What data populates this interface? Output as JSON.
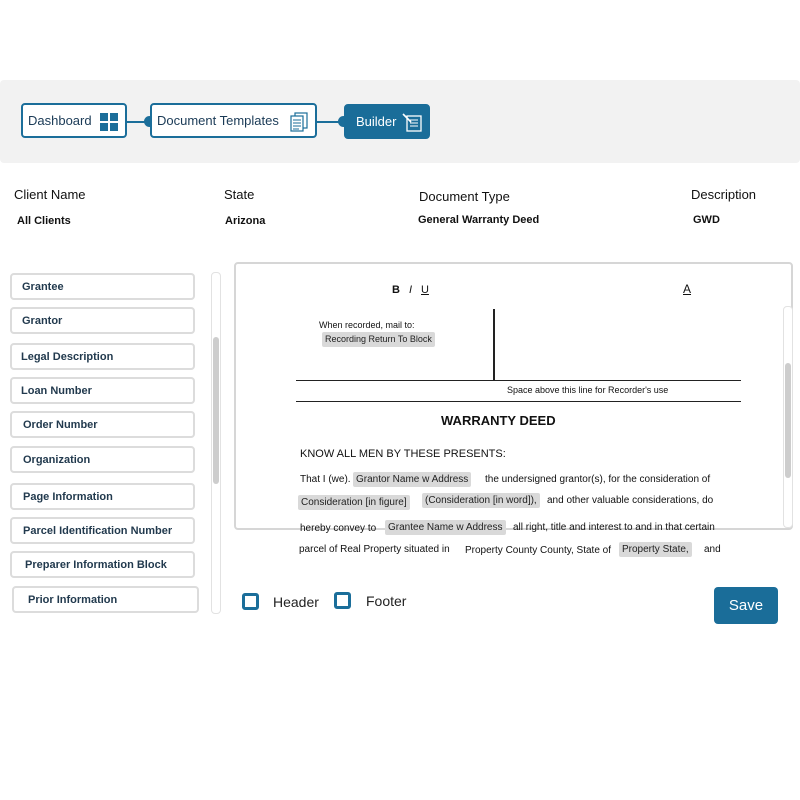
{
  "breadcrumb": {
    "dashboard": "Dashboard",
    "templates": "Document Templates",
    "builder": "Builder"
  },
  "info": {
    "client_label": "Client Name",
    "client_value": "All Clients",
    "state_label": "State",
    "state_value": "Arizona",
    "doctype_label": "Document Type",
    "doctype_value": "General Warranty Deed",
    "desc_label": "Description",
    "desc_value": "GWD"
  },
  "fields": [
    "Grantee",
    "Grantor",
    "Legal Description",
    "Loan Number",
    "Order Number",
    "Organization",
    "Page Information",
    "Parcel Identification Number",
    "Preparer Information Block",
    "Prior Information"
  ],
  "toolbar": {
    "bold": "B",
    "italic": "I",
    "underline": "U",
    "font_color": "A"
  },
  "document": {
    "mail_to": "When recorded, mail to:",
    "recording_tag": "Recording Return To Block",
    "recorder_note": "Space above this line for Recorder's use",
    "title": "WARRANTY DEED",
    "know_all": "KNOW ALL MEN BY THESE PRESENTS:",
    "l1_a": "That I (we).",
    "tag_grantor": "Grantor Name w Address",
    "l1_b": "the undersigned grantor(s), for the consideration of",
    "tag_cons_fig": "Consideration [in figure]",
    "tag_cons_word": "(Consideration [in word]),",
    "l2_b": "and other valuable considerations, do",
    "l3_a": "hereby convey to",
    "tag_grantee": "Grantee Name w Address",
    "l3_b": "all right, title and interest to and in that certain",
    "l4_a": "parcel of Real Property situated in",
    "l4_b": "Property County County, State of",
    "tag_state": "Property State,",
    "l4_c": "and"
  },
  "options": {
    "header": "Header",
    "footer": "Footer"
  },
  "save_label": "Save",
  "colors": {
    "accent": "#1a6d99",
    "tag_bg": "#d9d9d9"
  }
}
